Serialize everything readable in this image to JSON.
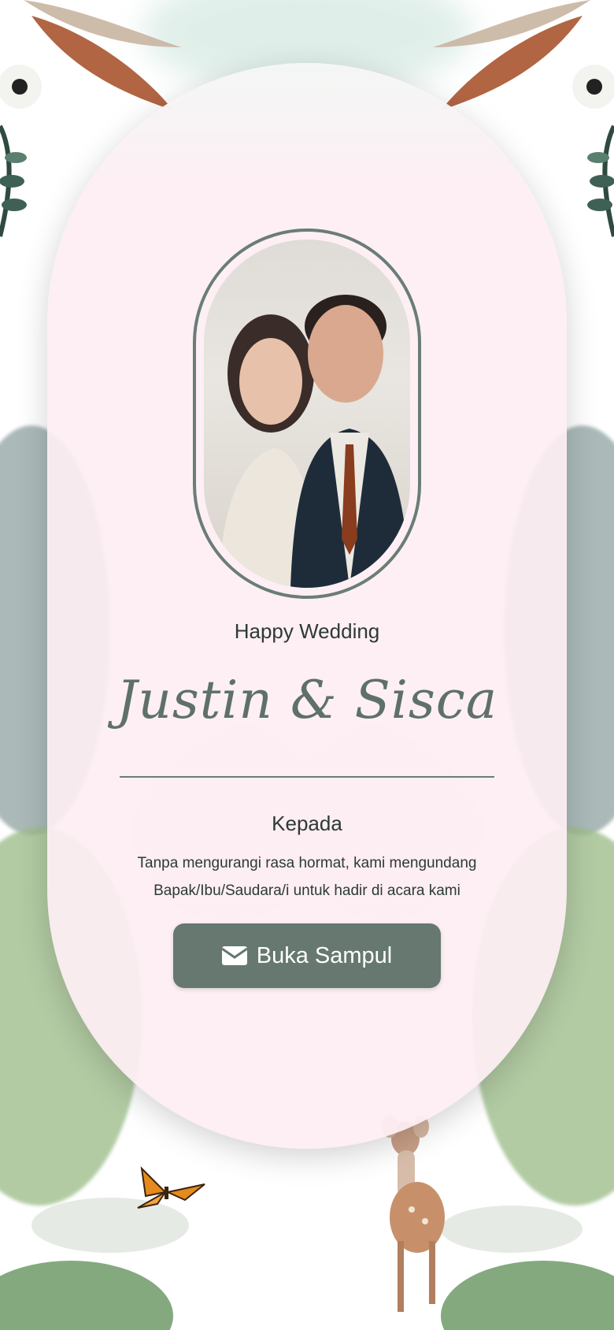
{
  "invitation": {
    "subtitle": "Happy Wedding",
    "couple_names": "Justin & Sisca",
    "to_label": "Kepada",
    "message_line_1": "Tanpa mengurangi rasa hormat, kami mengundang",
    "message_line_2": "Bapak/Ibu/Saudara/i untuk hadir di acara kami",
    "open_button_label": "Buka Sampul",
    "open_button_icon": "envelope-icon"
  },
  "colors": {
    "card_background": "#fdeef3",
    "accent": "#66786f",
    "frame": "#6a7d77",
    "text": "#2d3a36"
  }
}
